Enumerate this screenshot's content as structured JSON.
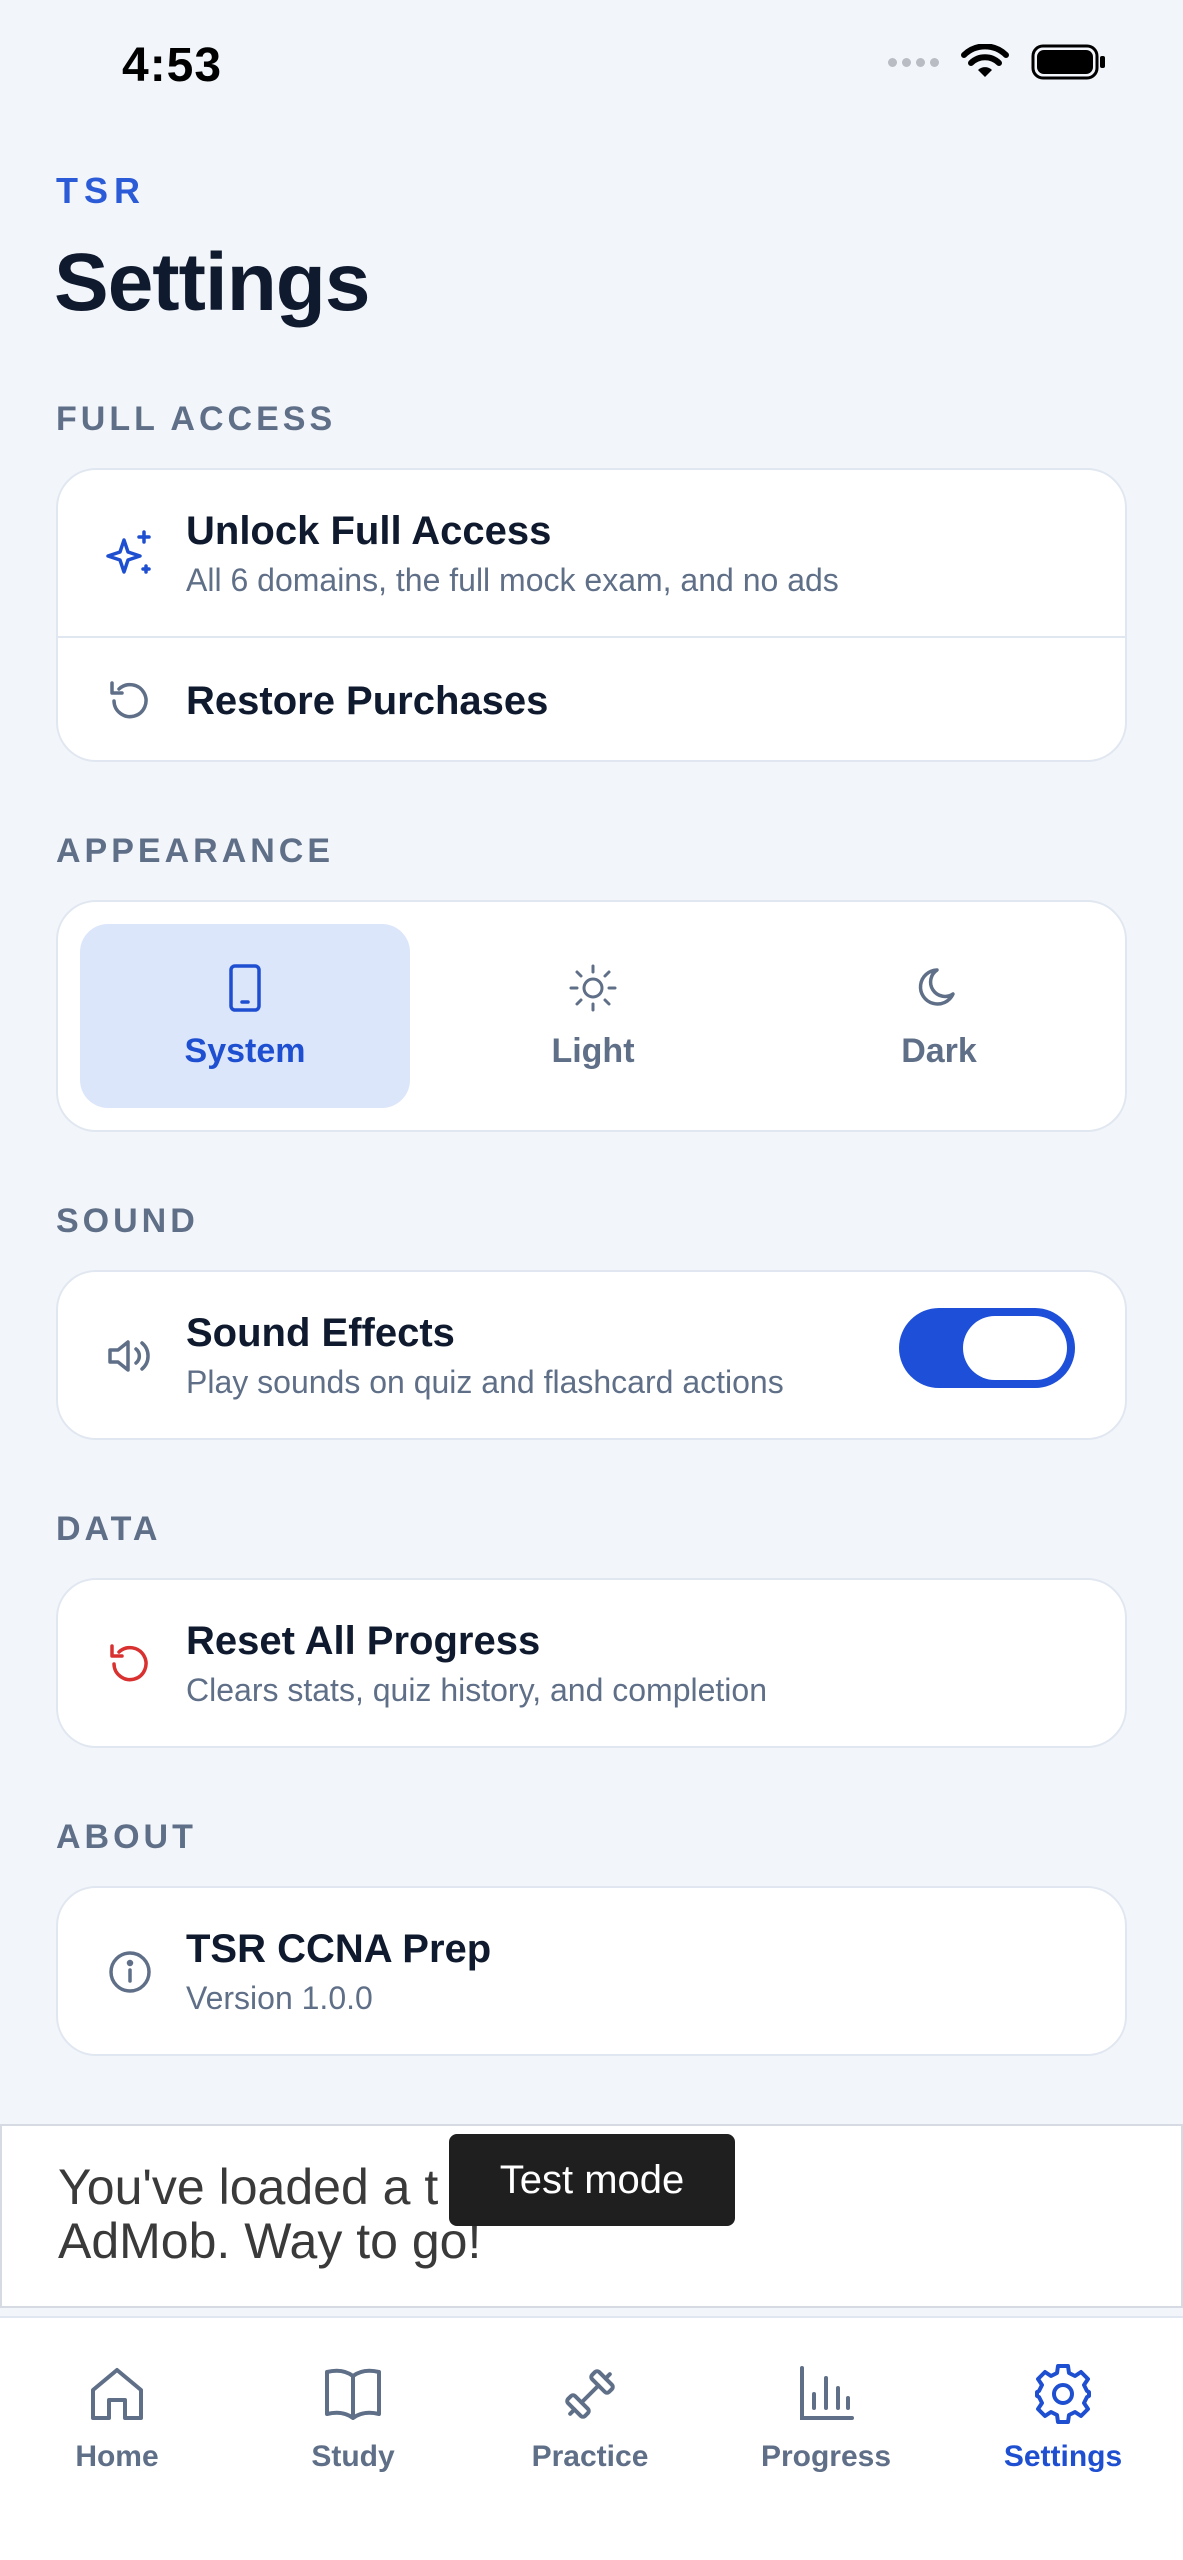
{
  "status_bar": {
    "time": "4:53"
  },
  "header": {
    "brand": "TSR",
    "title": "Settings"
  },
  "sections": {
    "full_access": {
      "header": "FULL ACCESS",
      "unlock": {
        "title": "Unlock Full Access",
        "subtitle": "All 6 domains, the full mock exam, and no ads",
        "icon": "sparkles-icon"
      },
      "restore": {
        "title": "Restore Purchases",
        "icon": "restore-icon"
      }
    },
    "appearance": {
      "header": "APPEARANCE",
      "options": [
        {
          "label": "System",
          "icon": "phone-icon",
          "selected": true
        },
        {
          "label": "Light",
          "icon": "sun-icon",
          "selected": false
        },
        {
          "label": "Dark",
          "icon": "moon-icon",
          "selected": false
        }
      ]
    },
    "sound": {
      "header": "SOUND",
      "effects": {
        "title": "Sound Effects",
        "subtitle": "Play sounds on quiz and flashcard actions",
        "enabled": true,
        "icon": "speaker-icon"
      }
    },
    "data": {
      "header": "DATA",
      "reset": {
        "title": "Reset All Progress",
        "subtitle": "Clears stats, quiz history, and completion",
        "icon": "reset-icon",
        "icon_color": "#d93030"
      }
    },
    "about": {
      "header": "ABOUT",
      "app": {
        "title": "TSR CCNA Prep",
        "subtitle": "Version 1.0.0",
        "icon": "info-icon"
      }
    }
  },
  "ad": {
    "text_line1": "You've loaded a t",
    "text_line2": "AdMob. Way to go!",
    "badge": "Test mode"
  },
  "tabbar": {
    "tabs": [
      {
        "label": "Home",
        "icon": "home-icon",
        "active": false
      },
      {
        "label": "Study",
        "icon": "book-icon",
        "active": false
      },
      {
        "label": "Practice",
        "icon": "dumbbell-icon",
        "active": false
      },
      {
        "label": "Progress",
        "icon": "bar-chart-icon",
        "active": false
      },
      {
        "label": "Settings",
        "icon": "gear-icon",
        "active": true
      }
    ]
  },
  "colors": {
    "accent": "#1f4fd1",
    "background": "#f2f5fa",
    "muted": "#5f6f87",
    "danger": "#d93030"
  }
}
